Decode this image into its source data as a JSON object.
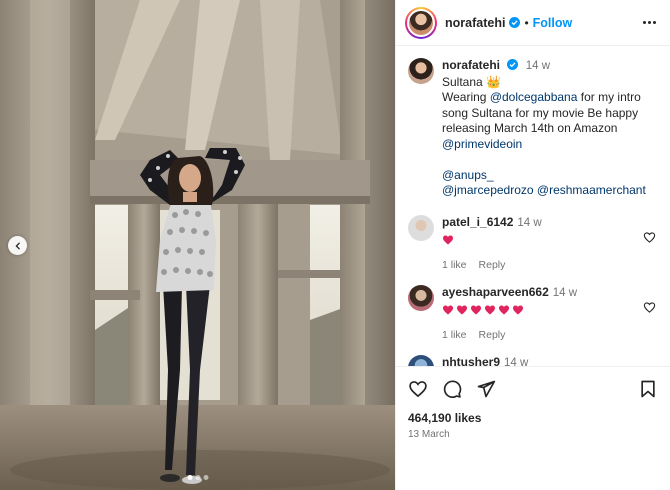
{
  "post": {
    "author": "norafatehi",
    "follow_label": "Follow",
    "separator": "•"
  },
  "caption": {
    "username": "norafatehi",
    "time": "14 w",
    "title": "Sultana 👑",
    "line1_pre": "Wearing ",
    "mention_dg": "@dolcegabbana",
    "line1_post": " for my intro song Sultana for my movie Be happy releasing March 14th on Amazon",
    "mention_prime": "@primevideoin",
    "mention_anups": "@anups_",
    "mention_jmarce": "@jmarcepedrozo",
    "mention_reshma": "@reshmaamerchant"
  },
  "comments": [
    {
      "username": "patel_i_6142",
      "time": "14 w",
      "hearts": 1,
      "likes": "1 like",
      "reply": "Reply"
    },
    {
      "username": "ayeshaparveen662",
      "time": "14 w",
      "hearts": 6,
      "likes": "1 like",
      "reply": "Reply"
    },
    {
      "username": "nhtusher9",
      "time": "14 w"
    }
  ],
  "footer": {
    "likes": "464,190 likes",
    "date": "13 March"
  },
  "carousel": {
    "dots": 3,
    "active": 0
  },
  "colors": {
    "link": "#0095f6",
    "mention": "#00376b",
    "heart": "#e0245e",
    "muted": "#737373"
  }
}
